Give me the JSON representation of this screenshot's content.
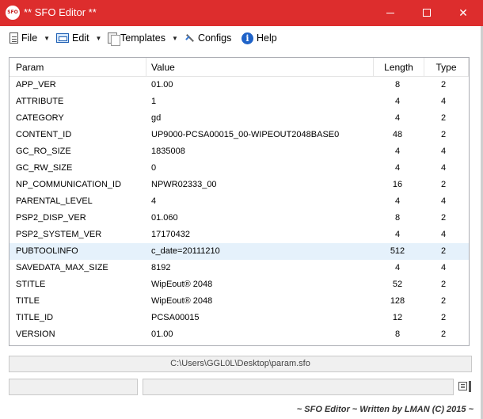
{
  "window": {
    "title": "** SFO Editor **",
    "icon_text": "SFO",
    "controls": {
      "minimize": "",
      "maximize": "",
      "close": "✕"
    }
  },
  "menu": {
    "file": "File",
    "edit": "Edit",
    "templates": "Templates",
    "configs": "Configs",
    "help": "Help",
    "help_glyph": "i"
  },
  "table": {
    "columns": [
      "Param",
      "Value",
      "Length",
      "Type"
    ],
    "rows": [
      {
        "param": "APP_VER",
        "value": "01.00",
        "length": "8",
        "type": "2"
      },
      {
        "param": "ATTRIBUTE",
        "value": "1",
        "length": "4",
        "type": "4"
      },
      {
        "param": "CATEGORY",
        "value": "gd",
        "length": "4",
        "type": "2"
      },
      {
        "param": "CONTENT_ID",
        "value": "UP9000-PCSA00015_00-WIPEOUT2048BASE0",
        "length": "48",
        "type": "2"
      },
      {
        "param": "GC_RO_SIZE",
        "value": "1835008",
        "length": "4",
        "type": "4"
      },
      {
        "param": "GC_RW_SIZE",
        "value": "0",
        "length": "4",
        "type": "4"
      },
      {
        "param": "NP_COMMUNICATION_ID",
        "value": "NPWR02333_00",
        "length": "16",
        "type": "2"
      },
      {
        "param": "PARENTAL_LEVEL",
        "value": "4",
        "length": "4",
        "type": "4"
      },
      {
        "param": "PSP2_DISP_VER",
        "value": "01.060",
        "length": "8",
        "type": "2"
      },
      {
        "param": "PSP2_SYSTEM_VER",
        "value": "17170432",
        "length": "4",
        "type": "4"
      },
      {
        "param": "PUBTOOLINFO",
        "value": "c_date=20111210",
        "length": "512",
        "type": "2"
      },
      {
        "param": "SAVEDATA_MAX_SIZE",
        "value": "8192",
        "length": "4",
        "type": "4"
      },
      {
        "param": "STITLE",
        "value": "WipEout® 2048",
        "length": "52",
        "type": "2"
      },
      {
        "param": "TITLE",
        "value": "WipEout® 2048",
        "length": "128",
        "type": "2"
      },
      {
        "param": "TITLE_ID",
        "value": "PCSA00015",
        "length": "12",
        "type": "2"
      },
      {
        "param": "VERSION",
        "value": "01.00",
        "length": "8",
        "type": "2"
      }
    ],
    "selected_index": 10,
    "selected_color": "#e5f1fb"
  },
  "path": "C:\\Users\\GGL0L\\Desktop\\param.sfo",
  "footer": "~ SFO Editor ~ Written by LMAN (C) 2015 ~",
  "colors": {
    "titlebar": "#dd2d2d",
    "accent": "#1f63c8"
  }
}
